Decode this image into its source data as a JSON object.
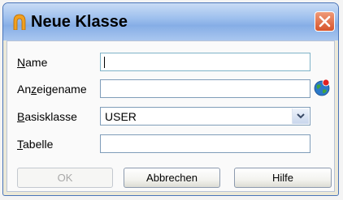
{
  "window": {
    "title": "Neue Klasse",
    "app_icon": "app-arch-icon",
    "close_icon": "close-icon"
  },
  "form": {
    "name": {
      "label_mnemonic": "N",
      "label_rest": "ame",
      "value": ""
    },
    "display_name": {
      "label_pre": "An",
      "label_mnemonic": "z",
      "label_rest": "eigename",
      "value": "",
      "globe_icon": "globe-icon"
    },
    "base_class": {
      "label_mnemonic": "B",
      "label_rest": "asisklasse",
      "value": "USER"
    },
    "table": {
      "label_mnemonic": "T",
      "label_rest": "abelle",
      "value": ""
    }
  },
  "buttons": {
    "ok": "OK",
    "cancel": "Abbrechen",
    "help": "Hilfe"
  },
  "colors": {
    "title_gradient": "#9ec0ee",
    "close": "#d6542c",
    "dialog_bg": "#fafafa"
  }
}
